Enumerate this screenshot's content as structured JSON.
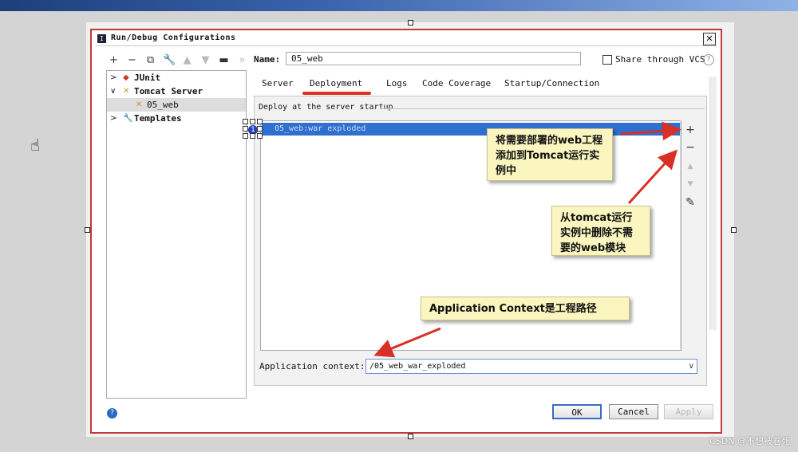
{
  "dialog": {
    "title": "Run/Debug Configurations",
    "close_glyph": "✕",
    "title_icon_glyph": "I"
  },
  "toolbar": {
    "add": "+",
    "remove": "−",
    "copy": "⧉",
    "edit_defaults": "🔧",
    "move_up": "▲",
    "move_down": "▼",
    "folder": "▬",
    "more": "»"
  },
  "tree": {
    "items": [
      {
        "label": "JUnit",
        "chevron": ">",
        "icon": "◆"
      },
      {
        "label": "Tomcat Server",
        "chevron": "∨",
        "icon": "✕"
      },
      {
        "label": "05_web",
        "icon": "✕"
      },
      {
        "label": "Templates",
        "chevron": ">",
        "icon": "🔧"
      }
    ]
  },
  "name": {
    "label": "Name:",
    "value": "05_web"
  },
  "share": {
    "label": "Share through VCS",
    "help": "?"
  },
  "tabs": [
    {
      "label": "Server"
    },
    {
      "label": "Deployment"
    },
    {
      "label": "Logs"
    },
    {
      "label": "Code Coverage"
    },
    {
      "label": "Startup/Connection"
    }
  ],
  "deploy": {
    "section_label": "Deploy at the server startup",
    "artifact": "05_web:war exploded",
    "badge": "1"
  },
  "side_buttons": {
    "add": "+",
    "remove": "−",
    "up": "▲",
    "down": "▼",
    "edit": "✎"
  },
  "context": {
    "label": "Application context:",
    "value": "/05_web_war_exploded",
    "dropdown": "∨"
  },
  "footer": {
    "help": "?",
    "ok": "OK",
    "cancel": "Cancel",
    "apply": "Apply"
  },
  "notes": {
    "note1": "将需要部署的web工程添加到Tomcat运行实例中",
    "note2": "从tomcat运行实例中删除不需要的web模块",
    "note3": "Application Context是工程路径"
  },
  "watermark": "CSDN @不想被卷死",
  "colors": {
    "dialog_border": "#c0393b",
    "selection": "#2f6fcf",
    "annotation_arrow": "#d83025",
    "note_background": "#fbf6bf"
  }
}
